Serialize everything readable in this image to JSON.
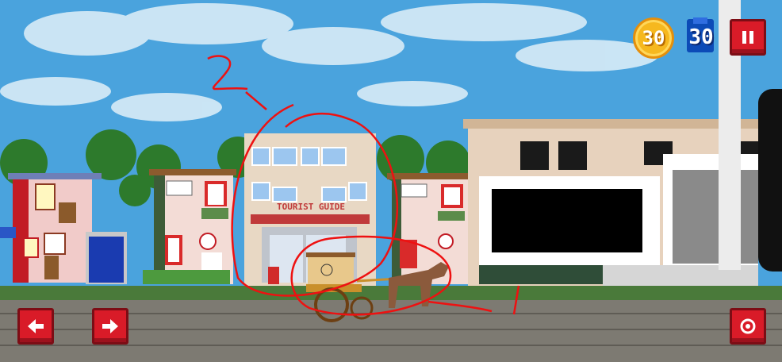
{
  "hud": {
    "coins": "30",
    "tickets": "30",
    "pause_icon": "pause-icon"
  },
  "building": {
    "sign": "TOURIST GUIDE"
  },
  "annotations": {
    "label_2": "2",
    "label_1": "1"
  },
  "controls": {
    "left_icon": "arrow-left-icon",
    "right_icon": "arrow-right-icon",
    "action_icon": "target-icon"
  },
  "colors": {
    "sky": "#4aa3dd",
    "accent_red": "#d91b28",
    "coin": "#f6b81f",
    "ticket": "#0c4bb7"
  }
}
